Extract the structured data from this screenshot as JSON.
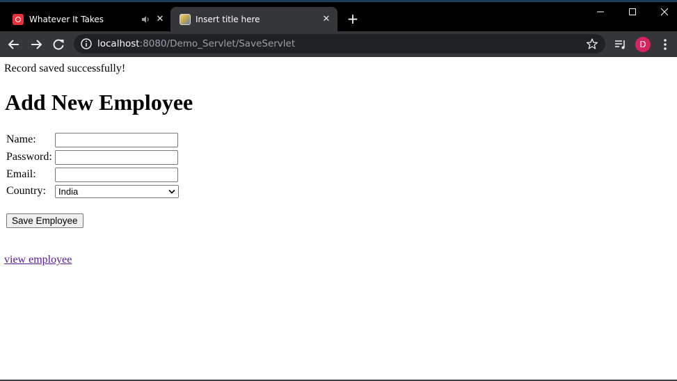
{
  "browser": {
    "tabs": [
      {
        "title": "Whatever It Takes",
        "favicon": "music-app-icon",
        "audio": true,
        "active": false
      },
      {
        "title": "Insert title here",
        "favicon": "page-image-icon",
        "audio": false,
        "active": true
      }
    ],
    "url": {
      "host": "localhost",
      "rest": ":8080/Demo_Servlet/SaveServlet"
    },
    "profile_initial": "D",
    "colors": {
      "tabstrip": "#000000",
      "toolbar": "#35363a",
      "omnibox": "#202124",
      "avatar": "#d7245e",
      "favicon_red": "#e6323c"
    }
  },
  "page": {
    "message": "Record saved successfully!",
    "heading": "Add New Employee",
    "form": {
      "name_label": "Name:",
      "name_value": "",
      "password_label": "Password:",
      "password_value": "",
      "email_label": "Email:",
      "email_value": "",
      "country_label": "Country:",
      "country_selected": "India",
      "submit_label": "Save Employee"
    },
    "link": "view employee",
    "colors": {
      "visited_link": "#551a8b"
    }
  }
}
